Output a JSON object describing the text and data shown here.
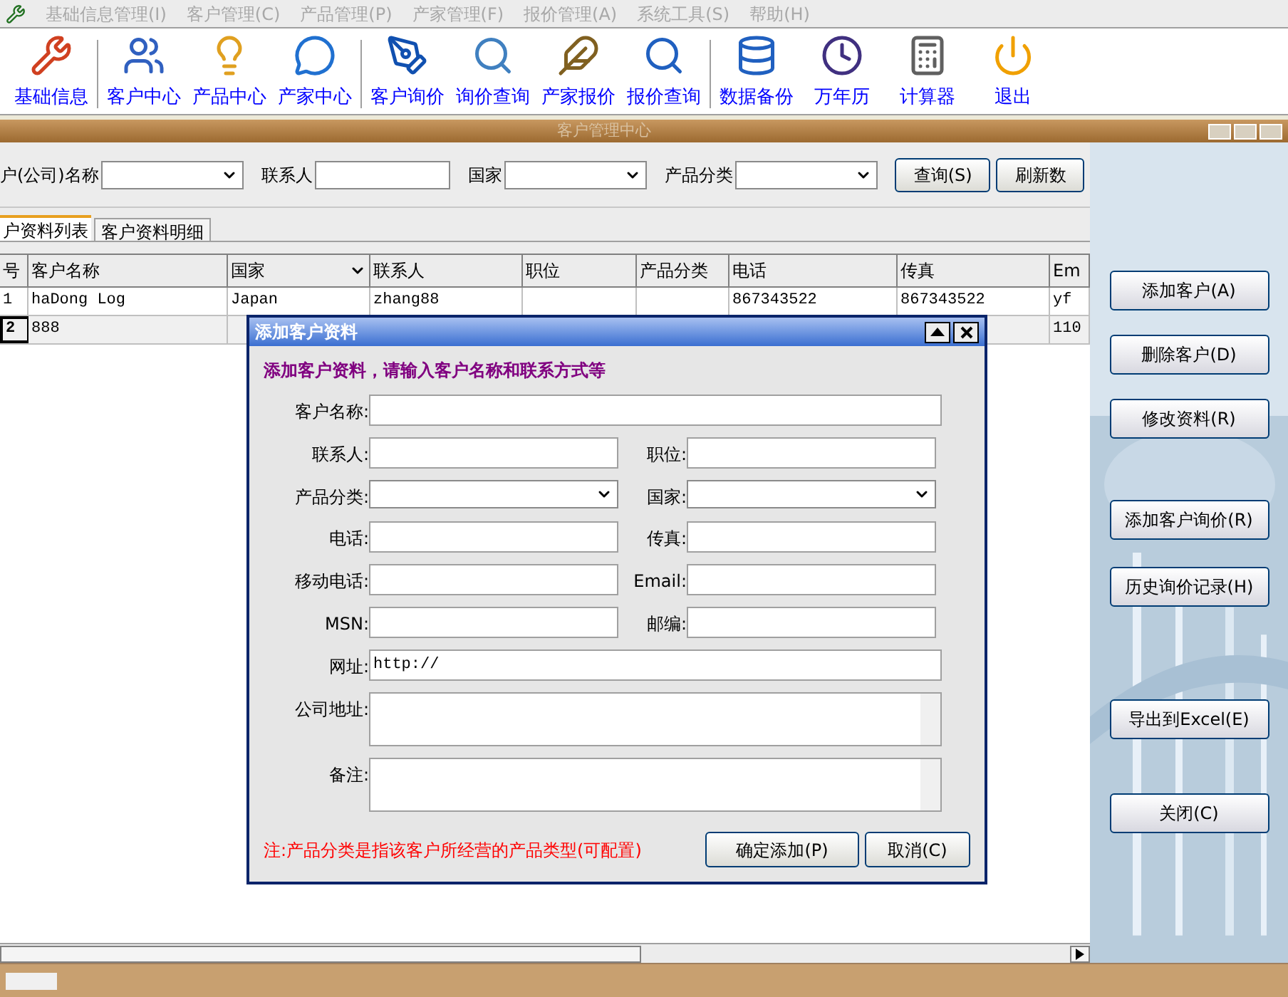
{
  "menu": [
    {
      "label": "基础信息管理(I)",
      "disabled": true
    },
    {
      "label": "客户管理(C)",
      "disabled": true
    },
    {
      "label": "产品管理(P)",
      "disabled": true
    },
    {
      "label": "产家管理(F)",
      "disabled": true
    },
    {
      "label": "报价管理(A)",
      "disabled": true
    },
    {
      "label": "系统工具(S)",
      "disabled": true
    },
    {
      "label": "帮助(H)",
      "disabled": true
    }
  ],
  "toolbar": [
    {
      "kind": "button",
      "label": "基础信息"
    },
    {
      "kind": "separator"
    },
    {
      "kind": "button",
      "label": "客户中心"
    },
    {
      "kind": "button",
      "label": "产品中心"
    },
    {
      "kind": "button",
      "label": "产家中心"
    },
    {
      "kind": "separator"
    },
    {
      "kind": "button",
      "label": "客户询价"
    },
    {
      "kind": "button",
      "label": "询价查询"
    },
    {
      "kind": "button",
      "label": "产家报价"
    },
    {
      "kind": "button",
      "label": "报价查询"
    },
    {
      "kind": "separator"
    },
    {
      "kind": "button",
      "label": "数据备份"
    },
    {
      "kind": "button",
      "label": "万年历"
    },
    {
      "kind": "button",
      "label": "计算器"
    },
    {
      "kind": "button",
      "label": "退出"
    }
  ],
  "window": {
    "title": "客户管理中心"
  },
  "search": [
    {
      "label": "户(公司)名称",
      "kind": "combo"
    },
    {
      "label": "联系人",
      "kind": "text"
    },
    {
      "label": "国家",
      "kind": "combo"
    },
    {
      "label": "产品分类",
      "kind": "combo"
    }
  ],
  "search_buttons": [
    "查询(S)",
    "刷新数"
  ],
  "tabs": [
    {
      "label": "户资料列表",
      "selected": true
    },
    {
      "label": "客户资料明细",
      "selected": false
    }
  ],
  "table": {
    "columns": [
      "号",
      "客户名称",
      "国家",
      "联系人",
      "职位",
      "产品分类",
      "电话",
      "传真",
      "Em"
    ],
    "rows": [
      {
        "no": "1",
        "name": "haDong Log",
        "country": "Japan",
        "contact": "zhang88",
        "phone": "867343522",
        "fax": "867343522",
        "email": "yf",
        "selected": false
      },
      {
        "no": "2",
        "name": "888",
        "email": "110",
        "selected": true
      }
    ]
  },
  "side_buttons": [
    "添加客户(A)",
    "删除客户(D)",
    "修改资料(R)",
    "添加客户询价(R)",
    "历史询价记录(H)",
    "导出到Excel(E)",
    "关闭(C)"
  ],
  "dialog": {
    "title": "添加客户资料",
    "hint": "添加客户资料，请输入客户名称和联系方式等",
    "rows": [
      [
        {
          "label": "客户名称:",
          "kind": "text"
        }
      ],
      [
        {
          "label": "联系人:",
          "kind": "text"
        },
        {
          "label": "职位:",
          "kind": "text"
        }
      ],
      [
        {
          "label": "产品分类:",
          "kind": "combo"
        },
        {
          "label": "国家:",
          "kind": "combo"
        }
      ],
      [
        {
          "label": "电话:",
          "kind": "text"
        },
        {
          "label": "传真:",
          "kind": "text"
        }
      ],
      [
        {
          "label": "移动电话:",
          "kind": "text"
        },
        {
          "label": "Email:",
          "kind": "text"
        }
      ],
      [
        {
          "label": "MSN:",
          "kind": "text"
        },
        {
          "label": "邮编:",
          "kind": "text"
        }
      ],
      [
        {
          "label": "网址:",
          "kind": "text",
          "value": "http://"
        }
      ],
      [
        {
          "label": "公司地址:",
          "kind": "memo"
        }
      ],
      [
        {
          "label": "备注:",
          "kind": "memo"
        }
      ]
    ],
    "note": "注:产品分类是指该客户所经营的产品类型(可配置)",
    "buttons": [
      "确定添加(P)",
      "取消(C)"
    ]
  }
}
